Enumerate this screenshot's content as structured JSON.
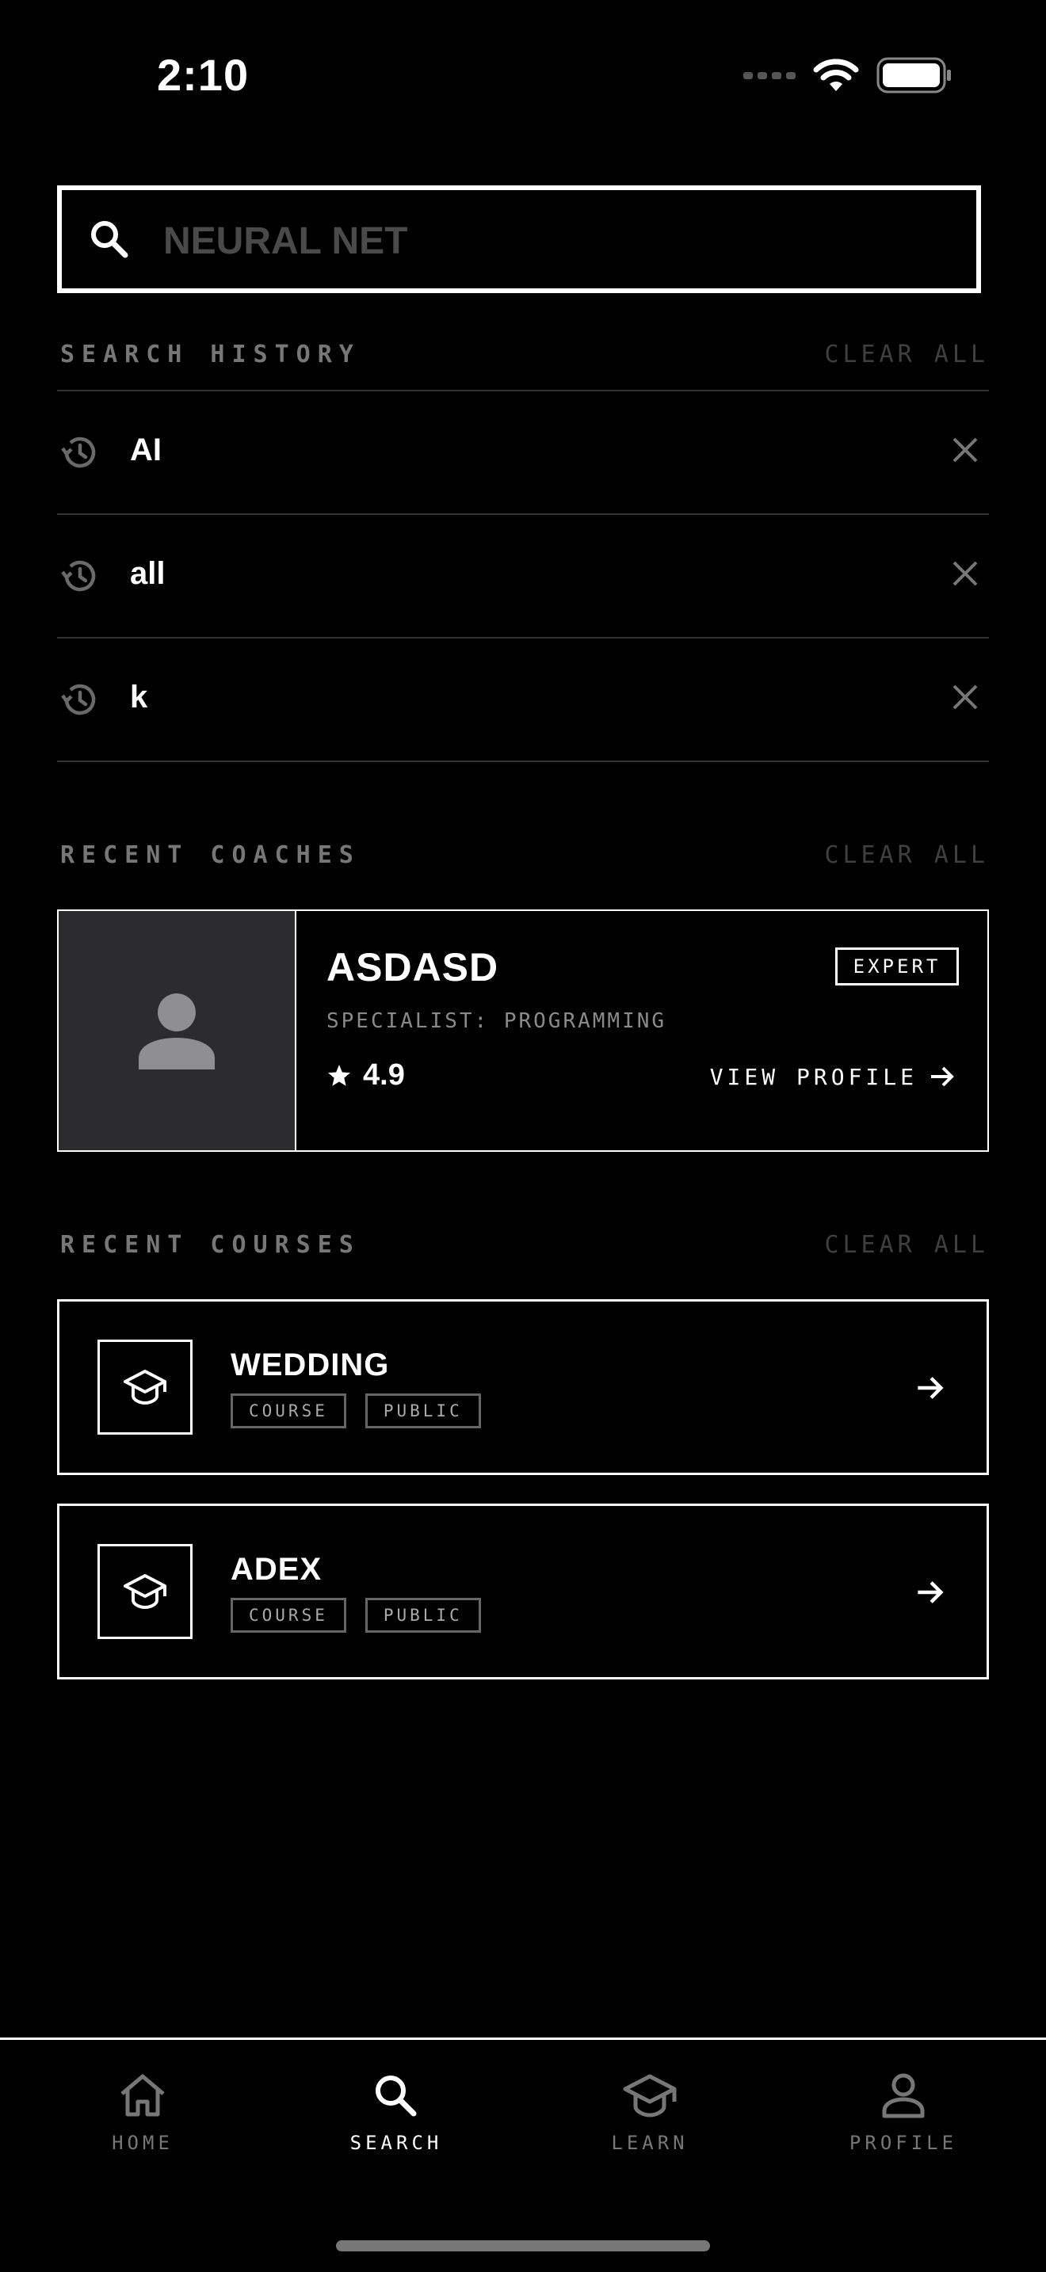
{
  "status_bar": {
    "time": "2:10"
  },
  "search": {
    "placeholder": "NEURAL NET"
  },
  "search_history": {
    "title": "SEARCH HISTORY",
    "clear_label": "CLEAR ALL",
    "items": [
      {
        "text": "AI"
      },
      {
        "text": "all"
      },
      {
        "text": "k"
      }
    ]
  },
  "recent_coaches": {
    "title": "RECENT COACHES",
    "clear_label": "CLEAR ALL",
    "coach": {
      "name": "ASDASD",
      "badge": "EXPERT",
      "specialty": "SPECIALIST: PROGRAMMING",
      "rating": "4.9",
      "view_label": "VIEW PROFILE"
    }
  },
  "recent_courses": {
    "title": "RECENT COURSES",
    "clear_label": "CLEAR ALL",
    "items": [
      {
        "title": "WEDDING",
        "tags": [
          "COURSE",
          "PUBLIC"
        ]
      },
      {
        "title": "ADEX",
        "tags": [
          "COURSE",
          "PUBLIC"
        ]
      }
    ]
  },
  "bottom_nav": {
    "items": [
      {
        "label": "HOME",
        "icon": "home-icon"
      },
      {
        "label": "SEARCH",
        "icon": "search-icon",
        "active": true
      },
      {
        "label": "LEARN",
        "icon": "graduation-cap-icon"
      },
      {
        "label": "PROFILE",
        "icon": "person-icon"
      }
    ]
  }
}
